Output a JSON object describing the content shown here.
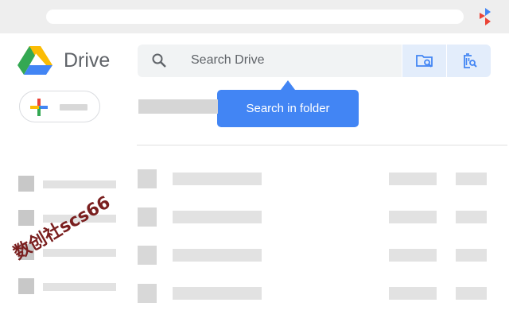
{
  "app": {
    "title": "Drive"
  },
  "search": {
    "placeholder": "Search Drive"
  },
  "tooltip": {
    "text": "Search in folder"
  },
  "watermark": {
    "text": "数创社scs66"
  },
  "colors": {
    "google_blue": "#4285f4",
    "google_red": "#ea4335",
    "google_yellow": "#fbbc04",
    "google_green": "#34a853",
    "text_gray": "#5f6368"
  },
  "icons": {
    "search": "search-icon",
    "folder_search": "folder-search-icon",
    "trash_search": "trash-search-icon",
    "new": "plus-icon",
    "extension": "extension-icon"
  }
}
